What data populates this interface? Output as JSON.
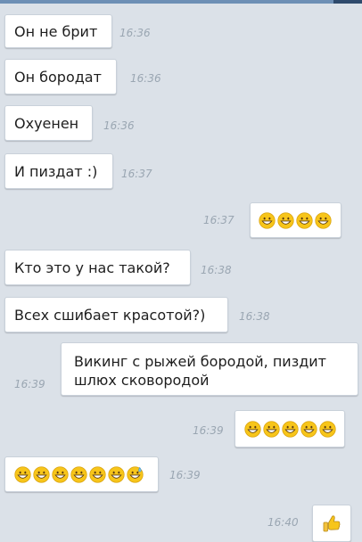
{
  "colors": {
    "background": "#dbe1e8",
    "bubble_in": "#ffffff",
    "bubble_out": "#ffffff",
    "bubble_border": "#c9d1da",
    "timestamp": "#9aa6b2",
    "text": "#1e1e1e",
    "emoji_face": "#f7c51a",
    "top_bar": "#6d8fb5"
  },
  "messages": [
    {
      "direction": "incoming",
      "text": "Он не брит",
      "time": "16:36"
    },
    {
      "direction": "incoming",
      "text": "Он бородат",
      "time": "16:36"
    },
    {
      "direction": "incoming",
      "text": "Охуенен",
      "time": "16:36"
    },
    {
      "direction": "incoming",
      "text": "И пиздат :)",
      "time": "16:37"
    },
    {
      "direction": "outgoing",
      "emoji": [
        "grin-face-icon",
        "grin-face-icon",
        "grin-face-icon",
        "grin-face-icon"
      ],
      "time": "16:37"
    },
    {
      "direction": "incoming",
      "text": "Кто это у нас такой?",
      "time": "16:38"
    },
    {
      "direction": "incoming",
      "text": "Всех сшибает красотой?)",
      "time": "16:38"
    },
    {
      "direction": "outgoing",
      "text_line1": "Викинг с рыжей бородой, пиздит",
      "text_line2": "шлюх сковородой",
      "time": "16:39"
    },
    {
      "direction": "outgoing",
      "emoji": [
        "grin-face-icon",
        "grin-face-icon",
        "grin-face-icon",
        "grin-face-icon",
        "grin-face-icon"
      ],
      "time": "16:39"
    },
    {
      "direction": "incoming",
      "emoji": [
        "grin-face-icon",
        "grin-face-icon",
        "grin-face-icon",
        "grin-face-icon",
        "grin-face-icon",
        "grin-face-icon",
        "sweat-grin-face-icon"
      ],
      "time": "16:39"
    },
    {
      "direction": "outgoing",
      "emoji": [
        "thumbs-up-icon"
      ],
      "time": "16:40"
    }
  ]
}
